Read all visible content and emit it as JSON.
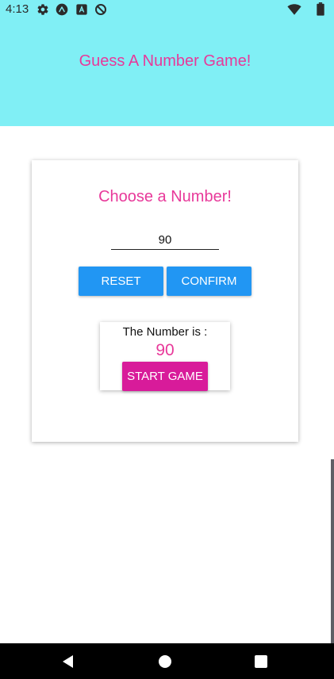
{
  "status_bar": {
    "time": "4:13",
    "left_icons": [
      "gear-icon",
      "expo-icon",
      "app-icon",
      "no-entry-icon"
    ],
    "right_icons": [
      "wifi-icon",
      "battery-icon"
    ]
  },
  "header": {
    "title": "Guess A Number Game!"
  },
  "start_screen": {
    "title": "Choose a Number!",
    "input": {
      "value": "90"
    },
    "reset_label": "RESET",
    "confirm_label": "CONFIRM"
  },
  "summary": {
    "label": "The Number is :",
    "number": "90",
    "start_label": "START GAME"
  },
  "colors": {
    "header_bg": "#80eff5",
    "accent_pink": "#e8399a",
    "button_blue": "#2196f3",
    "start_button": "#d81b9a"
  },
  "nav_bar": {
    "icons": [
      "back-icon",
      "home-icon",
      "recents-icon"
    ]
  }
}
